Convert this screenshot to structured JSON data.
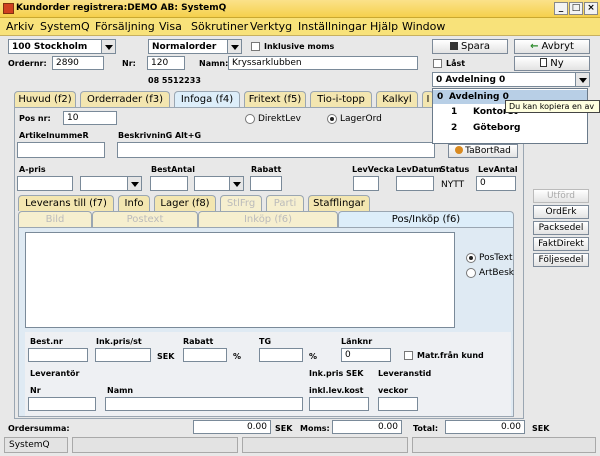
{
  "window": {
    "title": "Kundorder registrera:DEMO AB: SystemQ"
  },
  "menu": [
    "Arkiv",
    "SystemQ",
    "Försäljning",
    "Visa",
    "Sökrutiner",
    "Verktyg",
    "Inställningar",
    "Hjälp",
    "Window"
  ],
  "header": {
    "store_code": "100  Stockholm",
    "order_type": "Normalorder",
    "inclusive_vat_label": "Inklusive moms",
    "ordernr_label": "Ordernr:",
    "ordernr_value": "2890",
    "nr_label": "Nr:",
    "nr_value": "120",
    "name_label": "Namn:",
    "name_value": "Kryssarklubben",
    "phone": "08 5512233",
    "save_label": "Spara",
    "cancel_label": "Avbryt",
    "new_label": "Ny",
    "locked_label": "Låst",
    "department_value": "0  Avdelning 0"
  },
  "department_dropdown": {
    "options": [
      {
        "code": "0",
        "label": "Avdelning 0"
      },
      {
        "code": "1",
        "label": "Kontoret"
      },
      {
        "code": "2",
        "label": "Göteborg"
      }
    ],
    "tooltip": "Du kan kopiera en av"
  },
  "tabs": [
    "Huvud (f2)",
    "Orderrader (f3)",
    "Infoga (f4)",
    "Fritext (f5)",
    "Tio-i-topp",
    "Kalkyl",
    "I"
  ],
  "infoga": {
    "pos_label": "Pos nr:",
    "pos_value": "10",
    "direktlev_label": "DirektLev",
    "lagerord_label": "LagerOrd",
    "artikelnr_label": "ArtikelnummeR",
    "beskrivning_label": "BeskrivninG Alt+G",
    "taborad_label": "TaBortRad",
    "apris_label": "A-pris",
    "bestantal_label": "BestAntal",
    "rabatt_label": "Rabatt",
    "levvecka_label": "LevVecka",
    "levdatum_label": "LevDatum",
    "status_label": "Status",
    "levantal_label": "LevAntal",
    "status_value": "NYTT",
    "levantal_value": "0"
  },
  "subtabs": [
    "Leverans till (f7)",
    "Info",
    "Lager (f8)",
    "StlFrg",
    "Parti",
    "Stafflingar"
  ],
  "subtabs2": [
    "Bild",
    "Postext",
    "Inköp (f6)",
    "Pos/Inköp (f6)"
  ],
  "pos_inkop": {
    "postext_label": "PosText",
    "artbesk_label": "ArtBesk",
    "bestnr_label": "Best.nr",
    "inkpris_label": "Ink.pris/st",
    "rabatt_label": "Rabatt",
    "tg_label": "TG",
    "lanknr_label": "Länknr",
    "sek": "SEK",
    "pct": "%",
    "lanknr_value": "0",
    "matr_label": "Matr.från kund",
    "leverantor_label": "Leverantör",
    "inkpris_sek_label": "Ink.pris SEK",
    "leveranstid_label": "Leveranstid",
    "nr_label": "Nr",
    "namn_label": "Namn",
    "inkl_lev_label": "inkl.lev.kost",
    "veckor_label": "veckor"
  },
  "side_buttons": [
    "Utförd",
    "OrdErk",
    "Packsedel",
    "FaktDirekt",
    "Följesedel"
  ],
  "summary": {
    "ordersumma_label": "Ordersumma:",
    "ordersumma_value": "0.00",
    "sek": "SEK",
    "moms_label": "Moms:",
    "moms_value": "0.00",
    "total_label": "Total:",
    "total_value": "0.00"
  },
  "status": {
    "app": "SystemQ"
  }
}
